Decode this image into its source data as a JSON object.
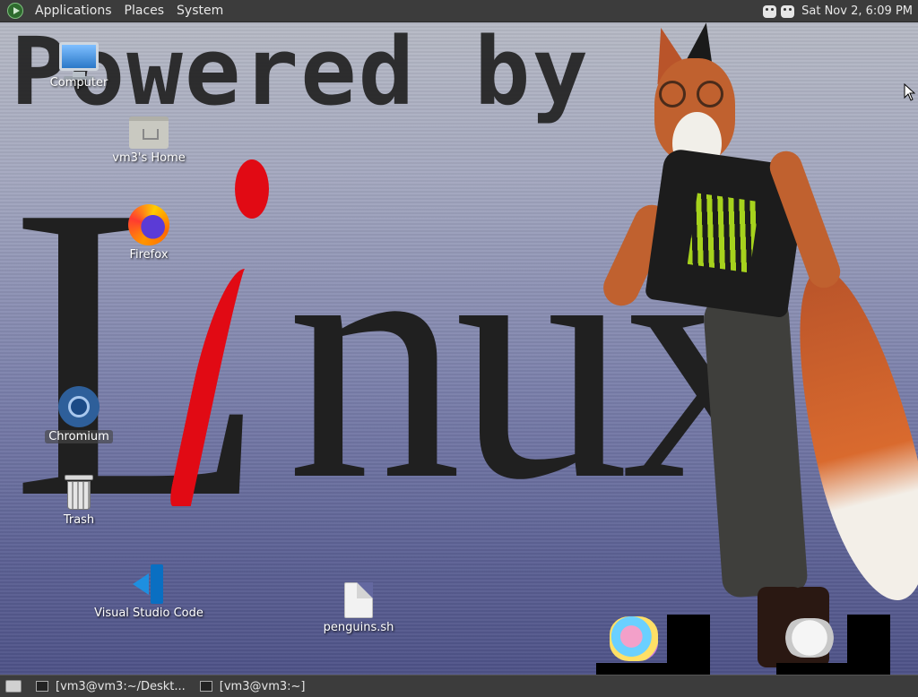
{
  "top_panel": {
    "menus": [
      "Applications",
      "Places",
      "System"
    ],
    "clock": "Sat Nov 2,  6:09 PM"
  },
  "wallpaper": {
    "powered_text": "Powered by",
    "linux_L": "L",
    "linux_nux": "nux"
  },
  "desktop_icons": {
    "computer": "Computer",
    "home": "vm3's Home",
    "firefox": "Firefox",
    "chromium": "Chromium",
    "trash": "Trash",
    "vscode": "Visual Studio Code",
    "penguins": "penguins.sh"
  },
  "taskbar": {
    "tasks": [
      "[vm3@vm3:~/Deskt...",
      "[vm3@vm3:~]"
    ]
  },
  "icons": {
    "computer": "monitor-icon",
    "home": "home-folder-icon",
    "firefox": "firefox-icon",
    "chromium": "chromium-icon",
    "trash": "trash-icon",
    "vscode": "vscode-icon",
    "penguins": "script-file-icon"
  }
}
